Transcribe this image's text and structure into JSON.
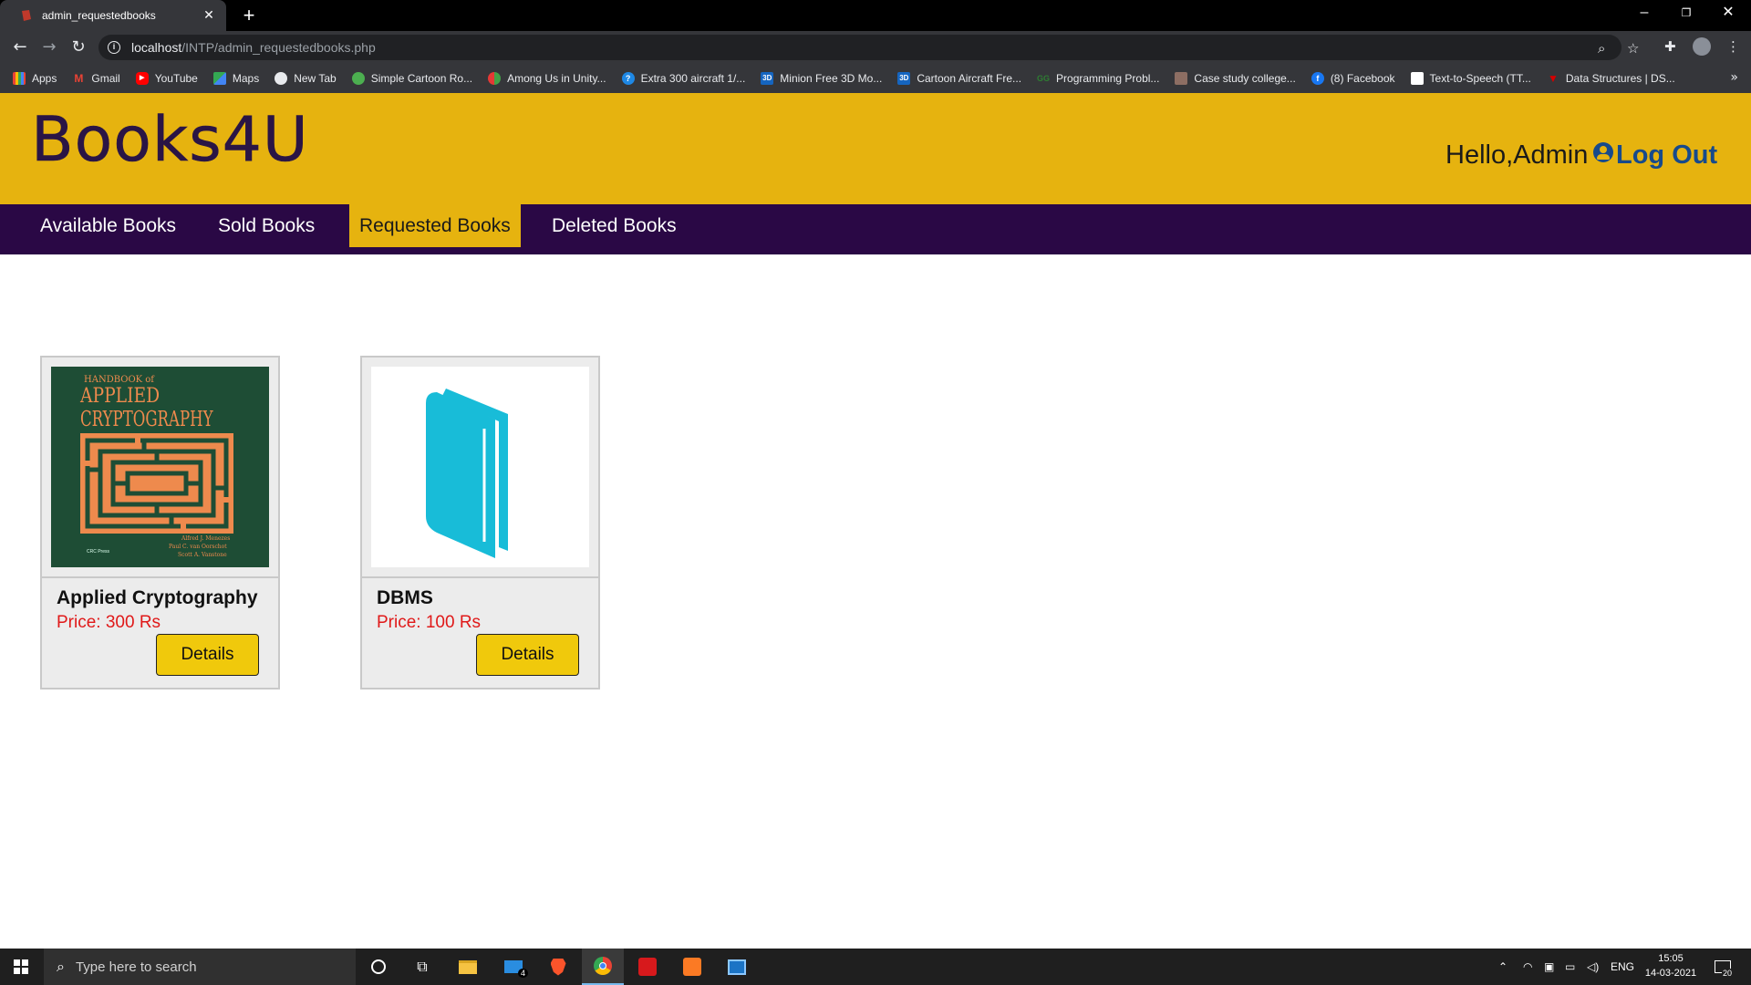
{
  "browser": {
    "tab_title": "admin_requestedbooks",
    "url_host": "localhost",
    "url_path": "/INTP/admin_requestedbooks.php",
    "bookmarks": [
      {
        "label": "Apps",
        "icon": "apps-grid-icon",
        "color": "#ea4335"
      },
      {
        "label": "Gmail",
        "icon": "gmail-icon",
        "color": "#ea4335"
      },
      {
        "label": "YouTube",
        "icon": "youtube-icon",
        "color": "#ff0000"
      },
      {
        "label": "Maps",
        "icon": "maps-icon",
        "color": "#34a853"
      },
      {
        "label": "New Tab",
        "icon": "globe-icon",
        "color": "#5f6368"
      },
      {
        "label": "Simple Cartoon Ro...",
        "icon": "site-icon",
        "color": "#4caf50"
      },
      {
        "label": "Among Us in Unity...",
        "icon": "site-icon",
        "color": "#e53935"
      },
      {
        "label": "Extra 300 aircraft 1/...",
        "icon": "site-icon",
        "color": "#1e88e5"
      },
      {
        "label": "Minion Free 3D Mo...",
        "icon": "3d-icon",
        "color": "#1565c0"
      },
      {
        "label": "Cartoon Aircraft Fre...",
        "icon": "3d-icon",
        "color": "#1565c0"
      },
      {
        "label": "Programming Probl...",
        "icon": "gfg-icon",
        "color": "#2e7d32"
      },
      {
        "label": "Case study college...",
        "icon": "site-icon",
        "color": "#8d6e63"
      },
      {
        "label": "(8) Facebook",
        "icon": "facebook-icon",
        "color": "#1877f2"
      },
      {
        "label": "Text-to-Speech (TT...",
        "icon": "site-icon",
        "color": "#ffffff"
      },
      {
        "label": "Data Structures | DS...",
        "icon": "site-icon",
        "color": "#d50000"
      }
    ]
  },
  "header": {
    "logo": "Books4U",
    "greeting": "Hello,Admin",
    "logout": "Log Out"
  },
  "nav": {
    "items": [
      "Available Books",
      "Sold Books",
      "Requested Books",
      "Deleted Books"
    ],
    "active": "Requested Books"
  },
  "books": [
    {
      "title": "Applied Cryptography",
      "price": "Price: 300 Rs",
      "button": "Details",
      "cover": {
        "line1": "HANDBOOK of",
        "line2": "APPLIED",
        "line3": "CRYPTOGRAPHY",
        "authors": [
          "Alfred J. Menezes",
          "Paul C. van Oorschot",
          "Scott A. Vanstone"
        ],
        "publisher": "CRC Press"
      }
    },
    {
      "title": "DBMS",
      "price": "Price: 100 Rs",
      "button": "Details"
    }
  ],
  "taskbar": {
    "search_placeholder": "Type here to search",
    "language": "ENG",
    "time": "15:05",
    "date": "14-03-2021",
    "notifications": "20",
    "mail_badge": "4"
  }
}
